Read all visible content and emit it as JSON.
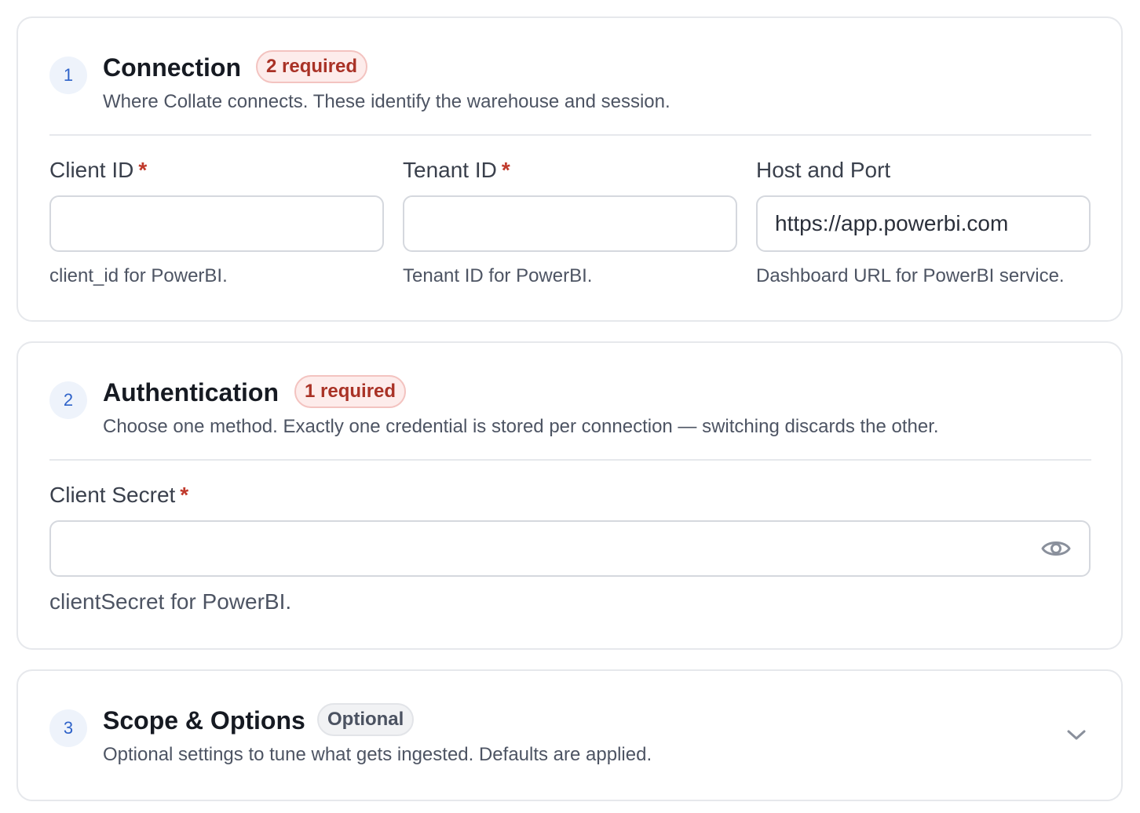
{
  "sections": [
    {
      "step": "1",
      "title": "Connection",
      "badge": "2 required",
      "subtitle": "Where Collate connects. These identify the warehouse and session.",
      "fields": [
        {
          "label": "Client ID",
          "required": "*",
          "value": "",
          "help": "client_id for PowerBI."
        },
        {
          "label": "Tenant ID",
          "required": "*",
          "value": "",
          "help": "Tenant ID for PowerBI."
        },
        {
          "label": "Host and Port",
          "value": "https://app.powerbi.com",
          "help": "Dashboard URL for PowerBI service."
        }
      ]
    },
    {
      "step": "2",
      "title": "Authentication",
      "badge": "1 required",
      "subtitle": "Choose one method. Exactly one credential is stored per connection — switching discards the other.",
      "fields": [
        {
          "label": "Client Secret",
          "required": "*",
          "value": "",
          "help": "clientSecret for PowerBI.",
          "icon": "eye-icon"
        }
      ]
    },
    {
      "step": "3",
      "title": "Scope & Options",
      "badge": "Optional",
      "subtitle": "Optional settings to tune what gets ingested. Defaults are applied.",
      "icon": "chevron-down-icon"
    }
  ],
  "colors": {
    "accent": "#2f63c9",
    "required": "#c0392b",
    "badge_required_bg": "#fdeceb",
    "badge_optional_bg": "#f1f2f4",
    "border": "#e6e8ec"
  }
}
